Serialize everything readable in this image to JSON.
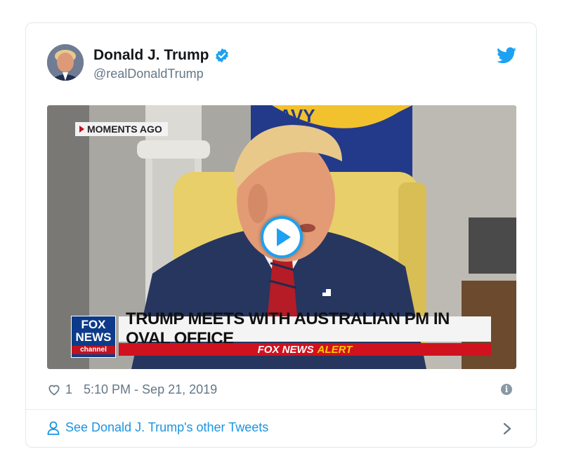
{
  "tweet": {
    "author_name": "Donald J. Trump",
    "author_handle": "@realDonaldTrump",
    "likes": "1",
    "timestamp": "5:10 PM - Sep 21, 2019",
    "footer_link": "See Donald J. Trump's other Tweets"
  },
  "video": {
    "badge": "MOMENTS AGO",
    "logo_line1": "FOX",
    "logo_line2": "NEWS",
    "logo_line3": "channel",
    "headline": "TRUMP MEETS WITH AUSTRALIAN PM IN OVAL OFFICE",
    "alert_fox": "FOX NEWS",
    "alert_word": "ALERT",
    "flag_text": "AVY"
  },
  "icons": {
    "verified": "verified-badge-icon",
    "twitter": "twitter-bird-icon",
    "play": "play-icon",
    "like": "heart-icon",
    "info": "info-icon",
    "person": "person-icon",
    "chevron": "chevron-right-icon"
  },
  "colors": {
    "brand": "#1da1f2",
    "link": "#1b95e0",
    "muted": "#657786",
    "fox_red": "#d0121f",
    "alert_yellow": "#ffcc00"
  }
}
